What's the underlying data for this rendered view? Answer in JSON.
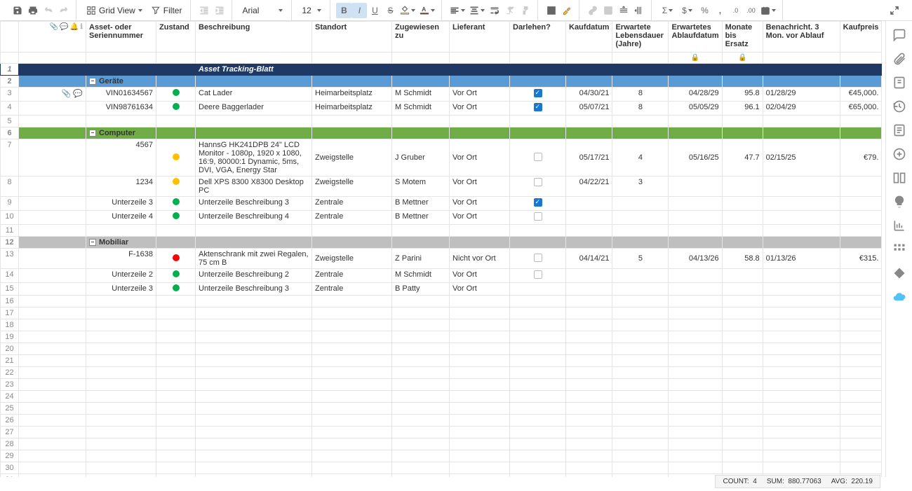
{
  "toolbar": {
    "view_label": "Grid View",
    "filter_label": "Filter",
    "font": "Arial",
    "font_size": "12"
  },
  "columns": [
    "Asset- oder Seriennummer",
    "Zustand",
    "Beschreibung",
    "Standort",
    "Zugewiesen zu",
    "Lieferant",
    "Darlehen?",
    "Kaufdatum",
    "Erwartete Lebensdauer (Jahre)",
    "Erwartetes Ablaufdatum",
    "Monate bis Ersatz",
    "Benachricht. 3 Mon. vor Ablauf",
    "Kaufpreis"
  ],
  "title_row": "Asset Tracking-Blatt",
  "groups": {
    "gerate": "Geräte",
    "computer": "Computer",
    "mobiliar": "Mobiliar"
  },
  "rows": {
    "r3": {
      "asset": "VIN01634567",
      "status": "green",
      "desc": "Cat Lader",
      "standort": "Heimarbeitsplatz",
      "zug": "M Schmidt",
      "lief": "Vor Ort",
      "darl": true,
      "kauf": "04/30/21",
      "leben": "8",
      "ablauf": "04/28/29",
      "monate": "95.8",
      "benach": "01/28/29",
      "preis": "€45,000."
    },
    "r4": {
      "asset": "VIN98761634",
      "status": "green",
      "desc": "Deere Baggerlader",
      "standort": "Heimarbeitsplatz",
      "zug": "M Schmidt",
      "lief": "Vor Ort",
      "darl": true,
      "kauf": "05/07/21",
      "leben": "8",
      "ablauf": "05/05/29",
      "monate": "96.1",
      "benach": "02/04/29",
      "preis": "€65,000."
    },
    "r7": {
      "asset": "4567",
      "status": "yellow",
      "desc": "HannsG HK241DPB 24\" LCD Monitor - 1080p, 1920 x 1080, 16:9, 80000:1 Dynamic, 5ms, DVI, VGA, Energy Star",
      "standort": "Zweigstelle",
      "zug": "J Gruber",
      "lief": "Vor Ort",
      "darl": false,
      "kauf": "05/17/21",
      "leben": "4",
      "ablauf": "05/16/25",
      "monate": "47.7",
      "benach": "02/15/25",
      "preis": "€79."
    },
    "r8": {
      "asset": "1234",
      "status": "yellow",
      "desc": "Dell XPS 8300 X8300 Desktop PC",
      "standort": "Zweigstelle",
      "zug": "S Motem",
      "lief": "Vor Ort",
      "darl": false,
      "kauf": "04/22/21",
      "leben": "3"
    },
    "r9": {
      "asset": "Unterzeile 3",
      "status": "green",
      "desc": "Unterzeile Beschreibung 3",
      "standort": "Zentrale",
      "zug": "B Mettner",
      "lief": "Vor Ort",
      "darl": true
    },
    "r10": {
      "asset": "Unterzeile 4",
      "status": "green",
      "desc": "Unterzeile Beschreibung 4",
      "standort": "Zentrale",
      "zug": "B Mettner",
      "lief": "Vor Ort",
      "darl": false
    },
    "r13": {
      "asset": "F-1638",
      "status": "red",
      "desc": "Aktenschrank mit zwei Regalen, 75 cm B",
      "standort": "Zweigstelle",
      "zug": "Z Parini",
      "lief": "Nicht vor Ort",
      "darl": false,
      "kauf": "04/14/21",
      "leben": "5",
      "ablauf": "04/13/26",
      "monate": "58.8",
      "benach": "01/13/26",
      "preis": "€315."
    },
    "r14": {
      "asset": "Unterzeile 2",
      "status": "green",
      "desc": "Unterzeile Beschreibung 2",
      "standort": "Zentrale",
      "zug": "M Schmidt",
      "lief": "Vor Ort",
      "darl": false
    },
    "r15": {
      "asset": "Unterzeile 3",
      "status": "green",
      "desc": "Unterzeile Beschreibung 3",
      "standort": "Zentrale",
      "zug": "B Patty",
      "lief": "Vor Ort"
    }
  },
  "statusbar": {
    "count_label": "COUNT:",
    "count": "4",
    "sum_label": "SUM:",
    "sum": "880.77063",
    "avg_label": "AVG:",
    "avg": "220.19"
  }
}
